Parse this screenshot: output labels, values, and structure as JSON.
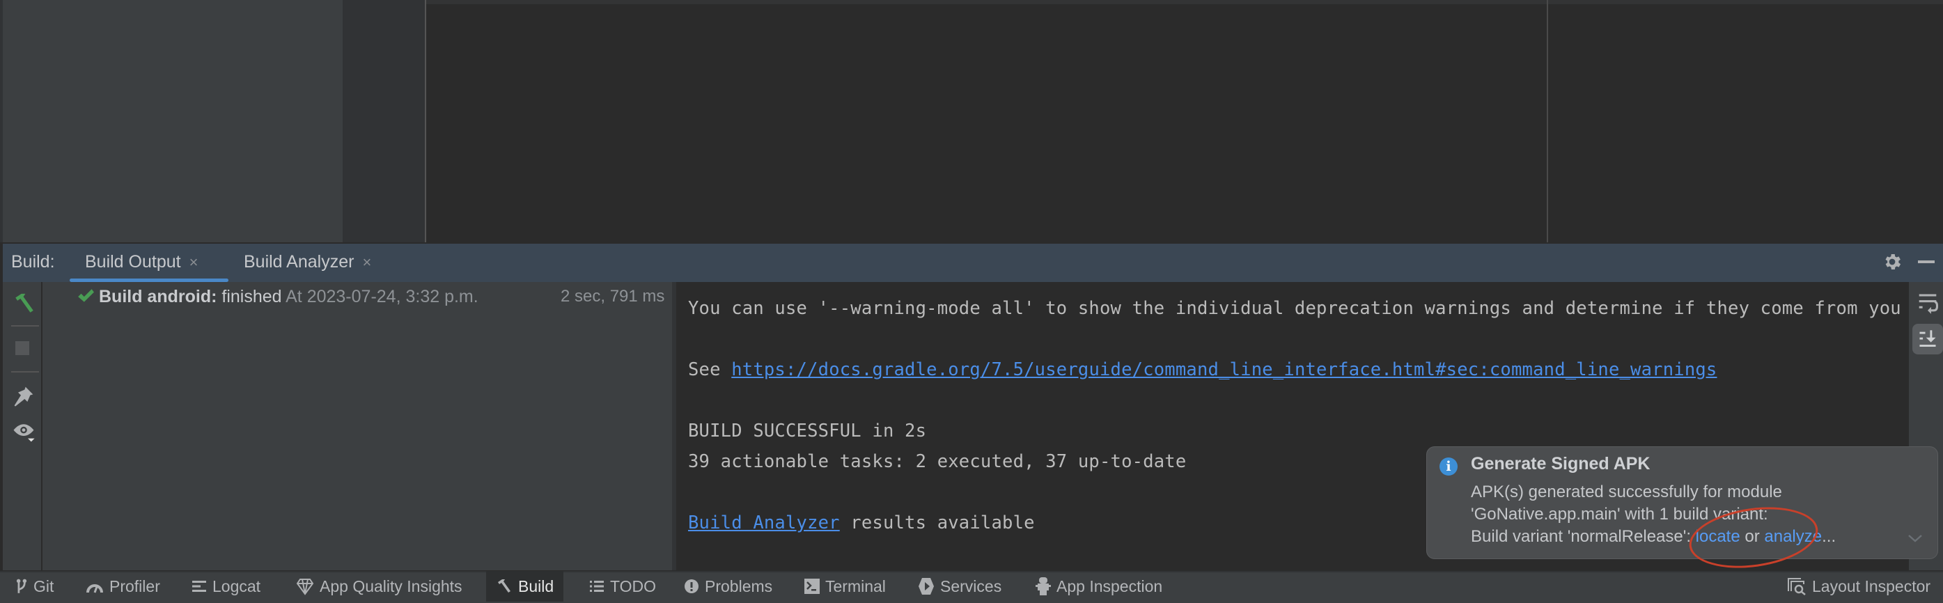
{
  "tool_window": {
    "label": "Build:",
    "tabs": [
      {
        "label": "Build Output",
        "active": true,
        "close": "×"
      },
      {
        "label": "Build Analyzer",
        "active": false,
        "close": "×"
      }
    ],
    "icons": {
      "settings": "gear-icon",
      "minimize": "minimize-icon"
    }
  },
  "left_toolbar": [
    "hammer-icon",
    "stop-icon",
    "pin-icon",
    "eye-icon"
  ],
  "build_tree": {
    "status_icon": "checkmark-icon",
    "title": "Build android:",
    "status": "finished",
    "timestamp": "At 2023-07-24, 3:32 p.m.",
    "duration": "2 sec, 791 ms"
  },
  "console": {
    "line1": "You can use '--warning-mode all' to show the individual deprecation warnings and determine if they come from your own scripts or plugins.",
    "line2_prefix": "See ",
    "line2_link": "https://docs.gradle.org/7.5/userguide/command_line_interface.html#sec:command_line_warnings",
    "line3": "BUILD SUCCESSFUL in 2s",
    "line4": "39 actionable tasks: 2 executed, 37 up-to-date",
    "line5_link": "Build Analyzer",
    "line5_suffix": " results available"
  },
  "right_toolbar": [
    "soft-wrap-icon",
    "scroll-to-end-icon"
  ],
  "notification": {
    "title": "Generate Signed APK",
    "line1": "APK(s) generated successfully for module",
    "line2": "'GoNative.app.main' with 1 build variant:",
    "line3_prefix": "Build variant 'normalRelease': ",
    "locate_link": "locate",
    "or_text": " or ",
    "analyze_link": "analyze",
    "ellipsis": "..."
  },
  "bottom_toolbar": [
    {
      "label": "Git",
      "icon": "git-branch-icon"
    },
    {
      "label": "Profiler",
      "icon": "gauge-icon"
    },
    {
      "label": "Logcat",
      "icon": "logcat-icon"
    },
    {
      "label": "App Quality Insights",
      "icon": "diamond-icon"
    },
    {
      "label": "Build",
      "icon": "hammer-icon",
      "active": true
    },
    {
      "label": "TODO",
      "icon": "list-icon"
    },
    {
      "label": "Problems",
      "icon": "exclamation-icon"
    },
    {
      "label": "Terminal",
      "icon": "terminal-icon"
    },
    {
      "label": "Services",
      "icon": "services-icon"
    },
    {
      "label": "App Inspection",
      "icon": "app-inspection-icon"
    },
    {
      "label": "Layout Inspector",
      "icon": "layout-inspector-icon"
    }
  ],
  "colors": {
    "accent": "#4a88c7",
    "link": "#4b8ee8",
    "success": "#499c54",
    "annotation": "#c9402a"
  }
}
